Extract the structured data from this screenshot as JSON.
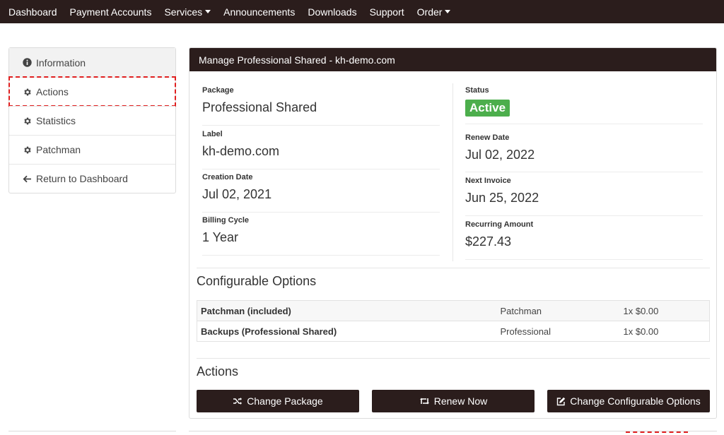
{
  "nav": {
    "items": [
      {
        "label": "Dashboard",
        "caret": false
      },
      {
        "label": "Payment Accounts",
        "caret": false
      },
      {
        "label": "Services",
        "caret": true
      },
      {
        "label": "Announcements",
        "caret": false
      },
      {
        "label": "Downloads",
        "caret": false
      },
      {
        "label": "Support",
        "caret": false
      },
      {
        "label": "Order",
        "caret": true
      }
    ]
  },
  "sidebar": {
    "items": [
      {
        "label": "Information",
        "icon": "info-circle-icon"
      },
      {
        "label": "Actions",
        "icon": "gear-icon"
      },
      {
        "label": "Statistics",
        "icon": "gear-icon"
      },
      {
        "label": "Patchman",
        "icon": "gear-icon"
      },
      {
        "label": "Return to Dashboard",
        "icon": "arrow-left-icon"
      }
    ]
  },
  "panel": {
    "title": "Manage Professional Shared - kh-demo.com",
    "left": [
      {
        "label": "Package",
        "value": "Professional Shared"
      },
      {
        "label": "Label",
        "value": "kh-demo.com"
      },
      {
        "label": "Creation Date",
        "value": "Jul 02, 2021"
      },
      {
        "label": "Billing Cycle",
        "value": "1 Year"
      }
    ],
    "right": {
      "status_label": "Status",
      "status_value": "Active",
      "renew_label": "Renew Date",
      "renew_value": "Jul 02, 2022",
      "invoice_label": "Next Invoice",
      "invoice_value": "Jun 25, 2022",
      "amount_label": "Recurring Amount",
      "amount_value": "$227.43"
    },
    "config_title": "Configurable Options",
    "config_rows": [
      {
        "name": "Patchman (included)",
        "option": "Patchman",
        "price": "1x $0.00"
      },
      {
        "name": "Backups (Professional Shared)",
        "option": "Professional",
        "price": "1x $0.00"
      }
    ],
    "actions_title": "Actions",
    "buttons": {
      "change_package": "Change Package",
      "renew_now": "Renew Now",
      "change_options": "Change Configurable Options"
    }
  },
  "colors": {
    "brand_dark": "#2b1d1c",
    "status_green": "#4cae4c",
    "highlight_red": "#e02020"
  }
}
